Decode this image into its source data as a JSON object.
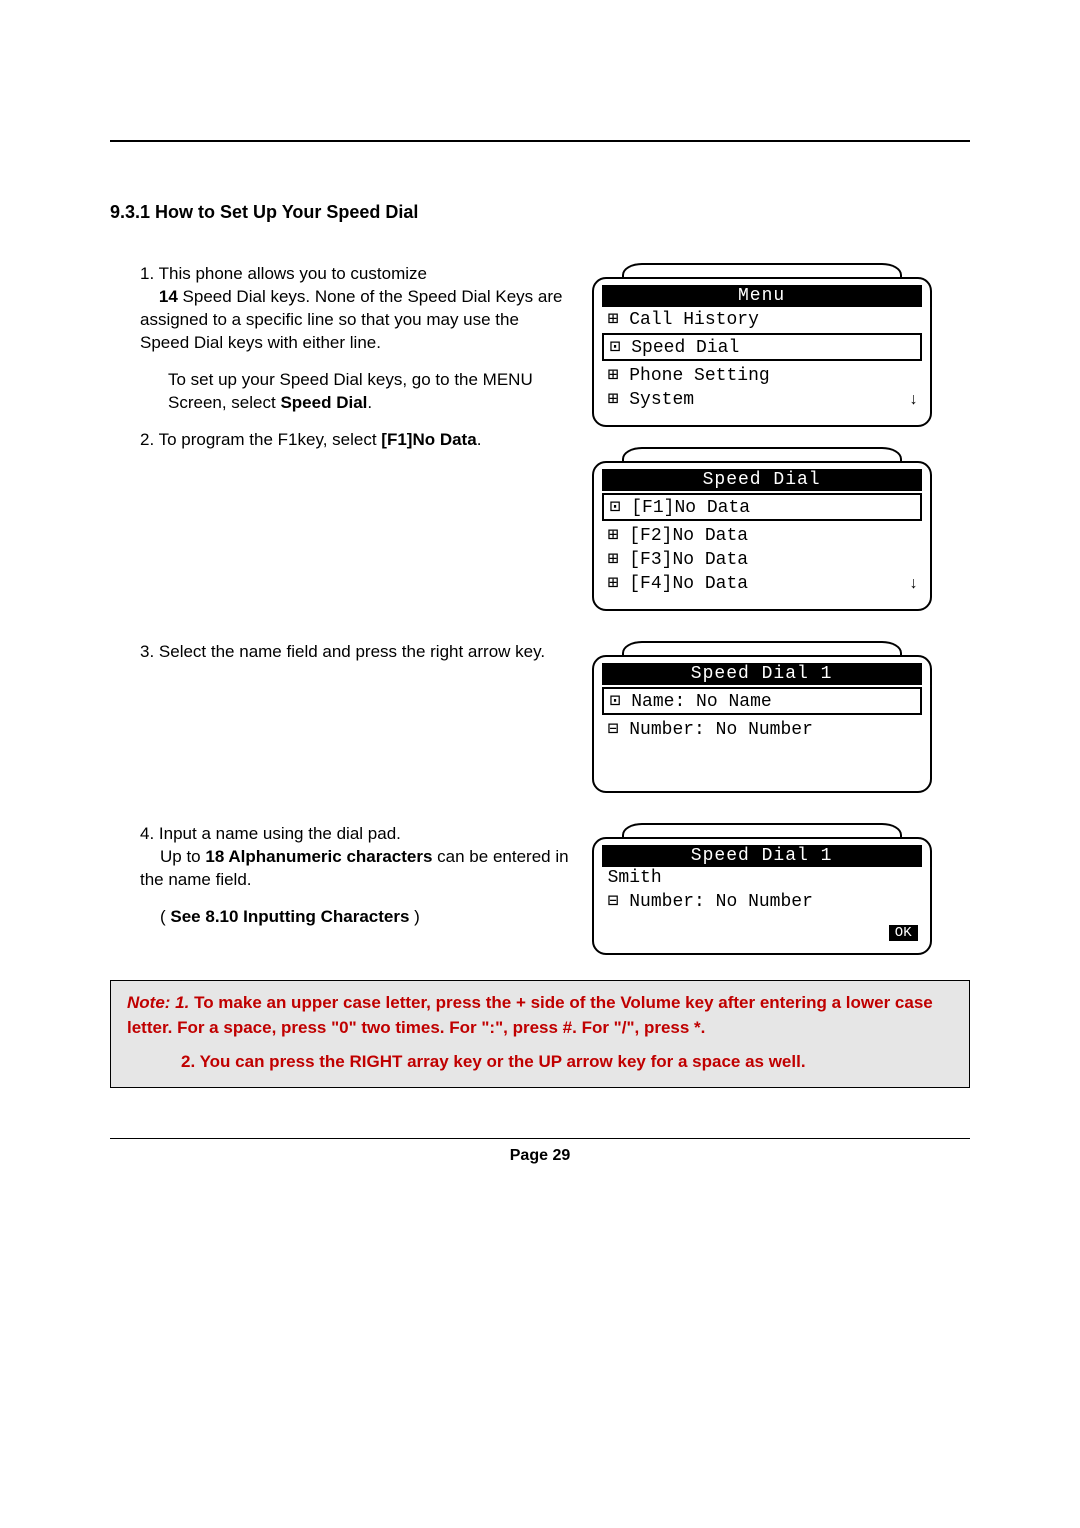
{
  "heading": "9.3.1 How to Set Up Your Speed Dial",
  "step1": {
    "num": "1.",
    "lead": " This phone allows you to customize",
    "count": "14",
    "rest1": " Speed Dial keys. None of the Speed Dial Keys are assigned to a specific line so that you may use the Speed Dial keys with either line.",
    "para2a": "To set up your Speed Dial keys, go to the MENU Screen, select ",
    "para2b": "Speed Dial",
    "para2c": "."
  },
  "step2": {
    "num": "2.",
    "text": " To program the F1key, select ",
    "bold": "[F1]No Data",
    "tail": "."
  },
  "step3": {
    "num": "3.",
    "text": " Select the name field and press the right arrow key."
  },
  "step4": {
    "num": "4",
    "lead": ". Input a name using the dial pad.",
    "line2a": "Up to ",
    "line2b": "18 Alphanumeric characters",
    "line2c": " can be entered in the name field.",
    "seeA": "( ",
    "seeB": "See 8.10 Inputting Characters",
    "seeC": " )"
  },
  "lcd1": {
    "title": "Menu",
    "lines": [
      "⊞ Call History",
      "⊡ Speed Dial",
      "⊞ Phone Setting",
      "⊞ System"
    ],
    "selected": 1,
    "arrow": "↓"
  },
  "lcd2": {
    "title": "Speed Dial",
    "lines": [
      "⊡ [F1]No Data",
      "⊞ [F2]No Data",
      "⊞ [F3]No Data",
      "⊞ [F4]No Data"
    ],
    "selected": 0,
    "arrow": "↓"
  },
  "lcd3": {
    "title": "Speed Dial 1",
    "lines": [
      "⊡ Name: No Name",
      "⊟ Number: No Number"
    ],
    "selected": 0
  },
  "lcd4": {
    "title": "Speed Dial 1",
    "lines": [
      "Smith",
      "⊟ Number: No Number"
    ],
    "ok": "OK"
  },
  "note": {
    "prefix": "Note: 1.",
    "body1": " To make an upper case letter, press the + side of the Volume key after entering a lower case letter. For a space, press \"0\" two times. For \":\", press #. For \"/\", press *.",
    "body2": "2. You can press the RIGHT array key or the UP arrow key for a space as well."
  },
  "footer": "Page 29"
}
